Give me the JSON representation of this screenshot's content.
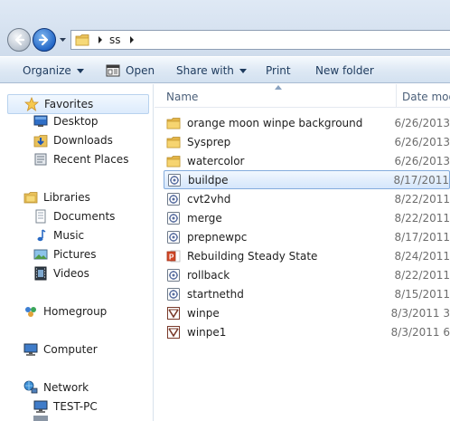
{
  "address_bar": {
    "crumbs": [
      "ss"
    ]
  },
  "toolbar": {
    "organize": "Organize",
    "open": "Open",
    "share_with": "Share with",
    "print": "Print",
    "new_folder": "New folder"
  },
  "nav": {
    "favorites": "Favorites",
    "desktop": "Desktop",
    "downloads": "Downloads",
    "recent_places": "Recent Places",
    "libraries": "Libraries",
    "documents": "Documents",
    "music": "Music",
    "pictures": "Pictures",
    "videos": "Videos",
    "homegroup": "Homegroup",
    "computer": "Computer",
    "network": "Network",
    "test_pc": "TEST-PC"
  },
  "columns": {
    "name": "Name",
    "date_modified": "Date mod"
  },
  "files": [
    {
      "name": "orange moon winpe background",
      "date": "6/26/2013",
      "icon": "folder-icon"
    },
    {
      "name": "Sysprep",
      "date": "6/26/2013",
      "icon": "folder-icon"
    },
    {
      "name": "watercolor",
      "date": "6/26/2013",
      "icon": "folder-icon"
    },
    {
      "name": "buildpe",
      "date": "8/17/2011",
      "icon": "script-file-icon",
      "selected": true
    },
    {
      "name": "cvt2vhd",
      "date": "8/22/2011",
      "icon": "script-file-icon"
    },
    {
      "name": "merge",
      "date": "8/22/2011",
      "icon": "script-file-icon"
    },
    {
      "name": "prepnewpc",
      "date": "8/17/2011",
      "icon": "script-file-icon"
    },
    {
      "name": "Rebuilding Steady State",
      "date": "8/24/2011",
      "icon": "powerpoint-file-icon"
    },
    {
      "name": "rollback",
      "date": "8/22/2011",
      "icon": "script-file-icon"
    },
    {
      "name": "startnethd",
      "date": "8/15/2011",
      "icon": "script-file-icon"
    },
    {
      "name": "winpe",
      "date": "8/3/2011 3",
      "icon": "visio-file-icon"
    },
    {
      "name": "winpe1",
      "date": "8/3/2011 6",
      "icon": "visio-file-icon"
    }
  ],
  "colors": {
    "selection_border": "#84acdd",
    "command_text": "#1e3b5e",
    "header_text": "#4c607a"
  }
}
